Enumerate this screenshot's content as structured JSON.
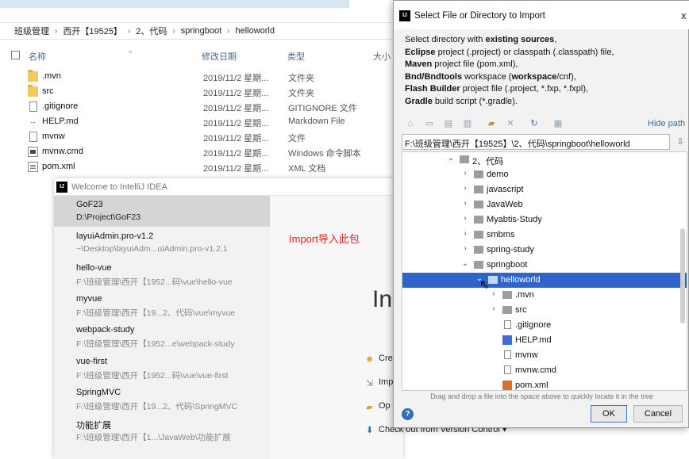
{
  "explorer": {
    "breadcrumb": [
      "班级管理",
      "西开【19525】",
      "2、代码",
      "springboot",
      "helloworld"
    ],
    "columns": {
      "name": "名称",
      "date": "修改日期",
      "type": "类型",
      "size": "大小"
    },
    "files": [
      {
        "name": ".mvn",
        "date": "2019/11/2 星期...",
        "type": "文件夹",
        "icon": "folder-icon"
      },
      {
        "name": "src",
        "date": "2019/11/2 星期...",
        "type": "文件夹",
        "icon": "folder-icon"
      },
      {
        "name": ".gitignore",
        "date": "2019/11/2 星期...",
        "type": "GITIGNORE 文件",
        "icon": "file-icon"
      },
      {
        "name": "HELP.md",
        "date": "2019/11/2 星期...",
        "type": "Markdown File",
        "icon": "markdown-file-icon"
      },
      {
        "name": "mvnw",
        "date": "2019/11/2 星期...",
        "type": "文件",
        "icon": "file-icon"
      },
      {
        "name": "mvnw.cmd",
        "date": "2019/11/2 星期...",
        "type": "Windows 命令脚本",
        "icon": "cmd-file-icon"
      },
      {
        "name": "pom.xml",
        "date": "2019/11/2 星期...",
        "type": "XML 文档",
        "icon": "xml-file-icon"
      }
    ]
  },
  "welcome": {
    "title": "Welcome to IntelliJ IDEA",
    "logo_text": "IJ",
    "recent": [
      {
        "name": "GoF23",
        "path": "D:\\Project\\GoF23"
      },
      {
        "name": "layuiAdmin.pro-v1.2",
        "path": "~\\Desktop\\layuiAdm...uiAdmin.pro-v1.2.1"
      },
      {
        "name": "hello-vue",
        "path": "F:\\班级管理\\西开【1952...码\\vue\\hello-vue"
      },
      {
        "name": "myvue",
        "path": "F:\\班级管理\\西开【19...2、代码\\vue\\myvue"
      },
      {
        "name": "webpack-study",
        "path": "F:\\班级管理\\西开【1952...e\\webpack-study"
      },
      {
        "name": "vue-first",
        "path": "F:\\班级管理\\西开【1952...码\\vue\\vue-first"
      },
      {
        "name": "SpringMVC",
        "path": "F:\\班级管理\\西开【19...2、代码\\SpringMVC"
      },
      {
        "name": "功能扩展",
        "path": "F:\\班级管理\\西开【1...\\JavaWeb\\功能扩展"
      }
    ],
    "big_text": "In",
    "actions": [
      {
        "icon": "star-icon",
        "label": "Cre"
      },
      {
        "icon": "import-icon",
        "label": "Imp"
      },
      {
        "icon": "open-folder-icon",
        "label": "Op"
      },
      {
        "icon": "checkout-icon",
        "label": "Check out from Version Control ▾"
      }
    ]
  },
  "annotation": "Import导入此包",
  "dialog": {
    "title": "Select File or Directory to Import",
    "close": "x",
    "desc": {
      "line1_pre": "Select directory with ",
      "line1_bold": "existing sources",
      "line1_post": ",",
      "line2_bold": "Eclipse",
      "line2_post": " project (.project) or classpath (.classpath) file,",
      "line3_bold": "Maven",
      "line3_post": " project file (pom.xml),",
      "line4_bold": "Bnd/Bndtools",
      "line4_mid": " workspace (",
      "line4_bold2": "workspace",
      "line4_post": "/cnf),",
      "line5_bold": "Flash Builder",
      "line5_post": " project file (.project, *.fxp, *.fxpl),",
      "line6_bold": "Gradle",
      "line6_post": " build script (*.gradle)."
    },
    "hide_path": "Hide path",
    "path": "F:\\班级管理\\西开【19525】\\2、代码\\springboot\\helloworld",
    "tree": [
      {
        "label": "2、代码",
        "level": 0,
        "expanded": true
      },
      {
        "label": "demo",
        "level": 1,
        "expanded": false
      },
      {
        "label": "javascript",
        "level": 1,
        "expanded": false
      },
      {
        "label": "JavaWeb",
        "level": 1,
        "expanded": false
      },
      {
        "label": "Myabtis-Study",
        "level": 1,
        "expanded": false
      },
      {
        "label": "smbms",
        "level": 1,
        "expanded": false
      },
      {
        "label": "spring-study",
        "level": 1,
        "expanded": false
      },
      {
        "label": "springboot",
        "level": 1,
        "expanded": true
      },
      {
        "label": "helloworld",
        "level": 2,
        "expanded": true,
        "selected": true
      },
      {
        "label": ".mvn",
        "level": 3,
        "expanded": false
      },
      {
        "label": "src",
        "level": 3,
        "expanded": false
      },
      {
        "label": ".gitignore",
        "level": 3,
        "file": "plain"
      },
      {
        "label": "HELP.md",
        "level": 3,
        "file": "md"
      },
      {
        "label": "mvnw",
        "level": 3,
        "file": "plain"
      },
      {
        "label": "mvnw.cmd",
        "level": 3,
        "file": "plain"
      },
      {
        "label": "pom.xml",
        "level": 3,
        "file": "xml"
      }
    ],
    "drag_hint": "Drag and drop a file into the space above to quickly locate it in the tree",
    "help": "?",
    "ok": "OK",
    "cancel": "Cancel"
  }
}
